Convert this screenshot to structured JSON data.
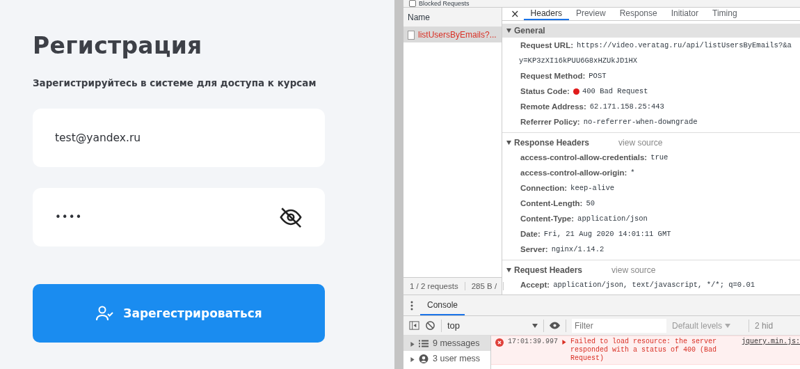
{
  "registration": {
    "title": "Регистрация",
    "subtitle": "Зарегистрируйтесь в системе для доступа к курсам",
    "email": {
      "value": "test@yandex.ru"
    },
    "password": {
      "value": "••••",
      "visible": false
    },
    "submit_button": {
      "label": "Зарегестрироваться"
    }
  },
  "devtools": {
    "blocked_requests": {
      "label": "Blocked Requests",
      "checked": false
    },
    "requests": {
      "column": "Name",
      "items": [
        {
          "name": "listUsersByEmails?...",
          "selected": true,
          "failed": true
        }
      ],
      "footer": [
        "1 / 2 requests",
        "285 B /"
      ]
    },
    "close": "×",
    "detail_tabs": [
      {
        "label": "Headers",
        "selected": true
      },
      {
        "label": "Preview",
        "selected": false
      },
      {
        "label": "Response",
        "selected": false
      },
      {
        "label": "Initiator",
        "selected": false
      },
      {
        "label": "Timing",
        "selected": false
      }
    ],
    "sections": [
      {
        "title": "General",
        "expanded": true,
        "rows": [
          {
            "kind": "plain",
            "key": "Request URL:",
            "value": "https://video.veratag.ru/api/listUsersByEmails?&a",
            "continuation": "y=KP3zXI16kPUU6G8xHZUkJD1HX"
          },
          {
            "kind": "plain",
            "key": "Request Method:",
            "value": "POST"
          },
          {
            "kind": "status",
            "key": "Status Code:",
            "value": "400 Bad Request"
          },
          {
            "kind": "plain",
            "key": "Remote Address:",
            "value": "62.171.158.25:443"
          },
          {
            "kind": "plain",
            "key": "Referrer Policy:",
            "value": "no-referrer-when-downgrade"
          }
        ]
      },
      {
        "title": "Response Headers",
        "expanded": true,
        "link": "view source",
        "rows": [
          {
            "kind": "plain",
            "key": "access-control-allow-credentials:",
            "value": "true"
          },
          {
            "kind": "plain",
            "key": "access-control-allow-origin:",
            "value": "*"
          },
          {
            "kind": "plain",
            "key": "Connection:",
            "value": "keep-alive"
          },
          {
            "kind": "plain",
            "key": "Content-Length:",
            "value": "50"
          },
          {
            "kind": "plain",
            "key": "Content-Type:",
            "value": "application/json"
          },
          {
            "kind": "plain",
            "key": "Date:",
            "value": "Fri, 21 Aug 2020 14:01:11 GMT"
          },
          {
            "kind": "plain",
            "key": "Server:",
            "value": "nginx/1.14.2"
          }
        ]
      },
      {
        "title": "Request Headers",
        "expanded": true,
        "link": "view source",
        "rows": [
          {
            "kind": "plain",
            "key": "Accept:",
            "value": "application/json, text/javascript, */*; q=0.01"
          }
        ]
      }
    ],
    "console": {
      "tab": {
        "label": "Console",
        "selected": true
      },
      "context": "top",
      "filter": {
        "placeholder": "Filter"
      },
      "levels": "Default levels",
      "hidden": "2 hid",
      "sidebar": [
        {
          "kind": "list",
          "label": "9 messages",
          "selected": true
        },
        {
          "kind": "user",
          "label": "3 user mess",
          "selected": false
        }
      ],
      "messages": [
        {
          "kind": "error",
          "time": "17:01:39.997",
          "text": "Failed to load resource: the server responded with a status of 400 (Bad Request)",
          "source": "jquery.min.js:"
        }
      ]
    }
  }
}
